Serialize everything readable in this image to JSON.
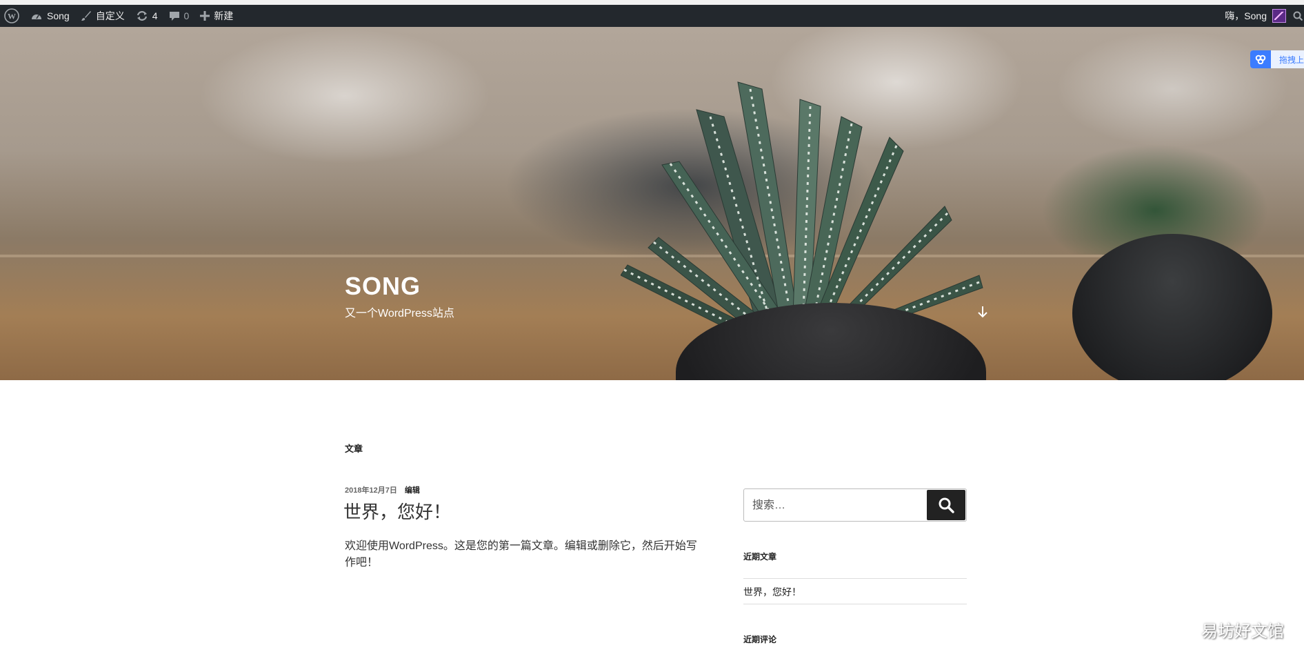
{
  "admin_bar": {
    "site_name": "Song",
    "customize_label": "自定义",
    "updates_count": "4",
    "comments_count": "0",
    "new_label": "新建",
    "greeting": "嗨，Song"
  },
  "header": {
    "site_title": "SONG",
    "site_description": "又一个WordPress站点",
    "drag_widget_label": "拖拽上"
  },
  "main": {
    "page_heading": "文章",
    "post": {
      "date": "2018年12月7日",
      "edit_label": "编辑",
      "title": "世界，您好！",
      "excerpt": "欢迎使用WordPress。这是您的第一篇文章。编辑或删除它，然后开始写作吧！"
    }
  },
  "sidebar": {
    "search_placeholder": "搜索…",
    "recent_posts_title": "近期文章",
    "recent_posts": [
      "世界，您好！"
    ],
    "recent_comments_title": "近期评论"
  },
  "watermark": "易坊好文馆",
  "colors": {
    "admin_bar_bg": "#23282d",
    "search_button_bg": "#222222",
    "accent_blue": "#3b7cff"
  }
}
